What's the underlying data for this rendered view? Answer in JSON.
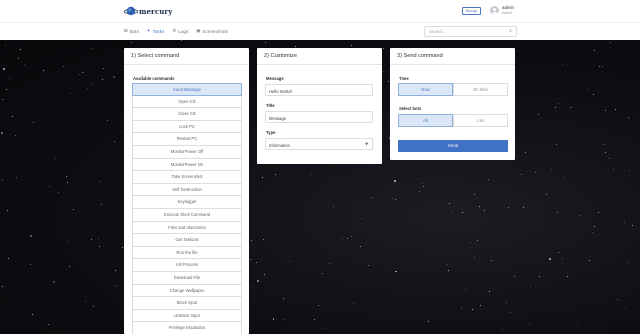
{
  "brand": {
    "name": "mercury"
  },
  "header": {
    "logout_label": "Выход",
    "user": {
      "name": "admin",
      "role": "Admin"
    }
  },
  "nav": {
    "items": [
      {
        "icon": "⊞",
        "label": "Bots"
      },
      {
        "icon": "✦",
        "label": "Tasks"
      },
      {
        "icon": "☰",
        "label": "Logs"
      },
      {
        "icon": "▣",
        "label": "Screenshots"
      }
    ],
    "active": "Tasks"
  },
  "search": {
    "placeholder": "Search...",
    "icon": "search-icon"
  },
  "select_command": {
    "title": "1) Select command",
    "available_label": "Available commands",
    "commands": [
      "Send Message",
      "Open CD",
      "Close CD",
      "Lock PC",
      "Restart PC",
      "MonitorPower Off",
      "MonitorPower On",
      "Take Screenshot",
      "Self Destruction",
      "Keylogger",
      "Execute Shell Command",
      "Files and directories",
      "Get TaskList",
      "Run the file",
      "Kill Process",
      "Download File",
      "Change Wallpaper",
      "Block input",
      "Unblock Input",
      "Privilege Escalation"
    ],
    "selected": "Send Message"
  },
  "customize": {
    "title": "2) Customize",
    "message_label": "Message",
    "message_value": "Hello World!",
    "title_label": "Title",
    "title_value": "Message",
    "type_label": "Type",
    "type_value": "Information"
  },
  "send_command": {
    "title": "3) Send command",
    "time_label": "Time",
    "time_options": [
      "Now",
      "On time"
    ],
    "time_selected": "Now",
    "bots_label": "Select bots",
    "bots_options": [
      "All",
      "List"
    ],
    "bots_selected": "All",
    "send_label": "Send"
  },
  "colors": {
    "accent": "#3f72c5",
    "selected_bg": "#dbe7f6",
    "background": "#0b0c0f"
  }
}
